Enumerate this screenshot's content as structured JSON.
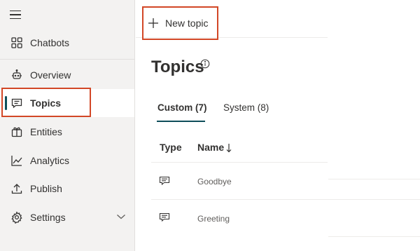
{
  "sidebar": {
    "items": [
      {
        "label": "Chatbots",
        "icon": "grid-icon"
      },
      {
        "label": "Overview",
        "icon": "bot-icon"
      },
      {
        "label": "Topics",
        "icon": "chat-icon",
        "active": true
      },
      {
        "label": "Entities",
        "icon": "entities-icon"
      },
      {
        "label": "Analytics",
        "icon": "chart-icon"
      },
      {
        "label": "Publish",
        "icon": "upload-icon"
      },
      {
        "label": "Settings",
        "icon": "gear-icon"
      }
    ]
  },
  "toolbar": {
    "new_topic_label": "New topic"
  },
  "page": {
    "title": "Topics"
  },
  "tabs": [
    {
      "label": "Custom (7)",
      "active": true
    },
    {
      "label": "System (8)",
      "active": false
    }
  ],
  "table": {
    "columns": [
      "Type",
      "Name"
    ],
    "sort_indicator": "↓",
    "rows": [
      {
        "name": "Goodbye"
      },
      {
        "name": "Greeting"
      }
    ]
  },
  "colors": {
    "highlight": "#d24726",
    "accent": "#0e4e5a",
    "sidebar_bg": "#f3f2f1"
  }
}
